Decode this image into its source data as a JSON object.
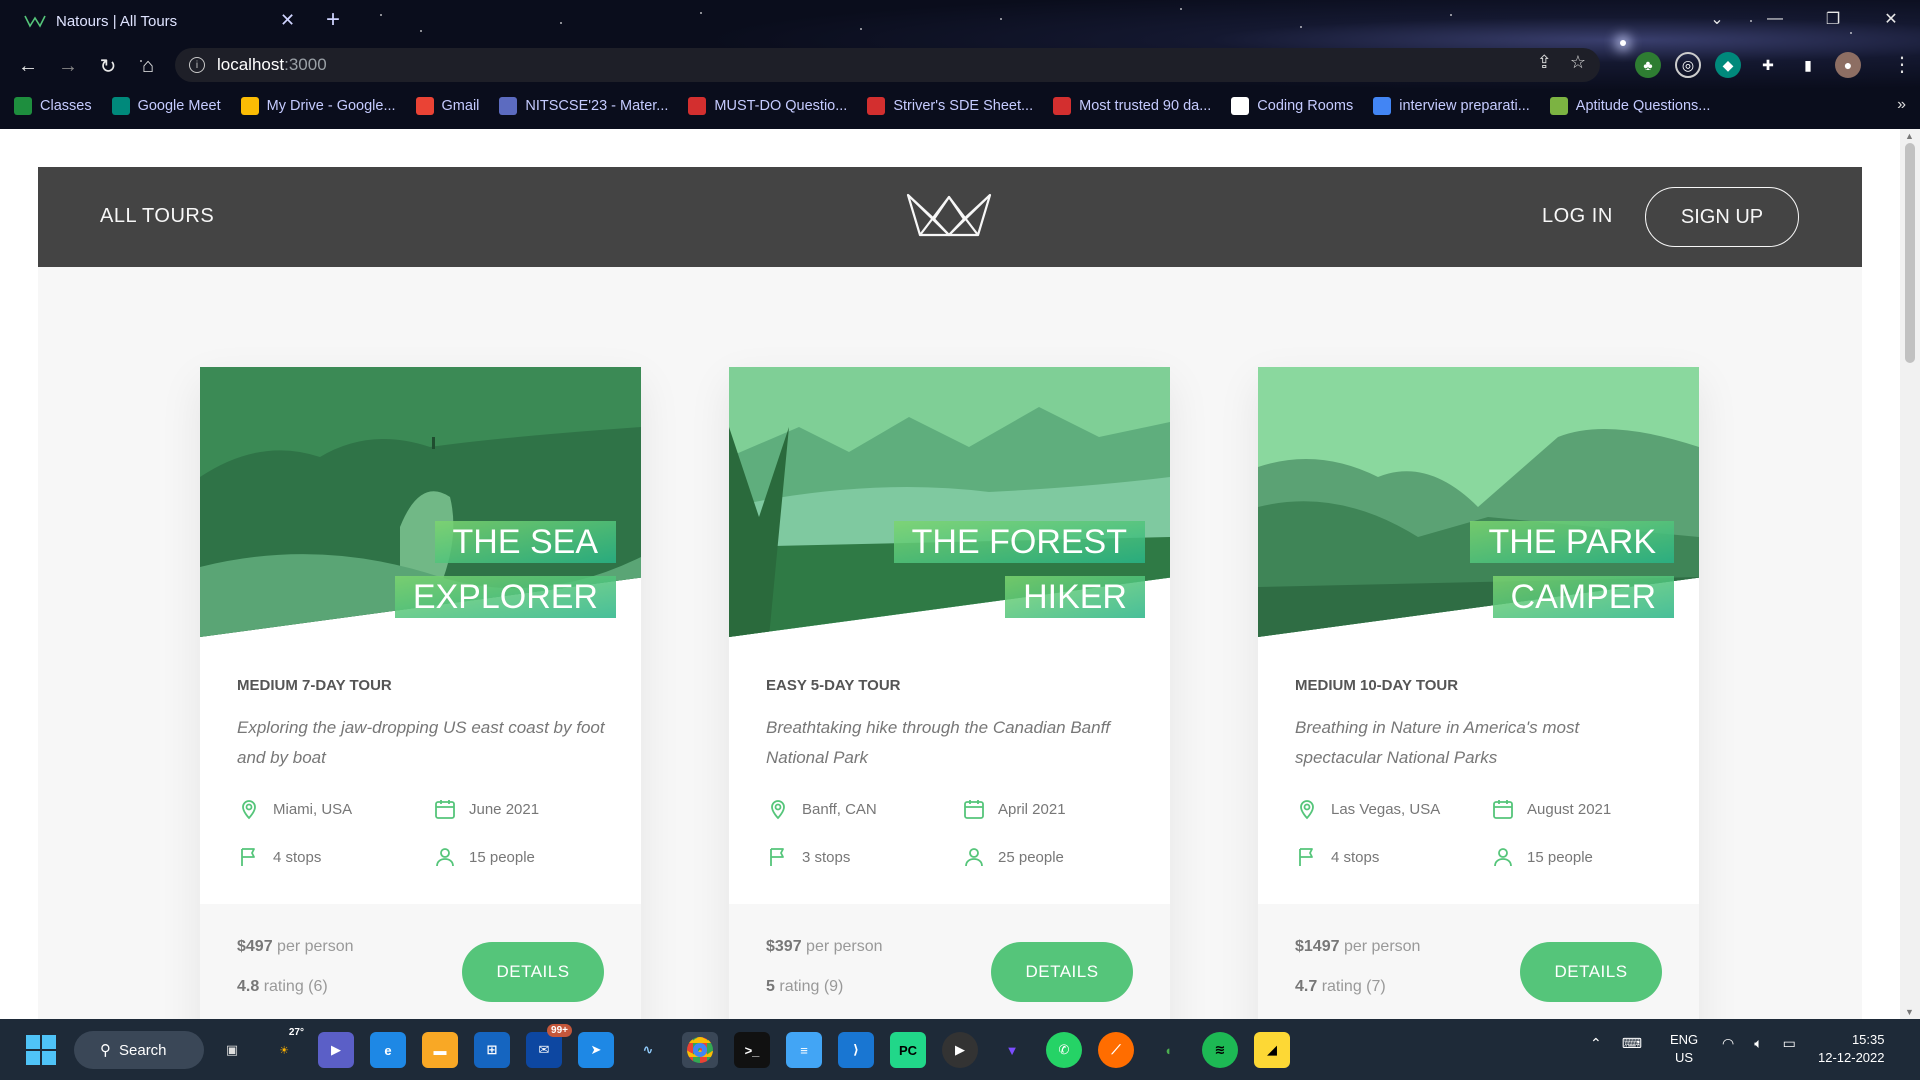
{
  "browser": {
    "tab_title": "Natours | All Tours",
    "url_host": "localhost",
    "url_port": ":3000",
    "bookmarks": [
      {
        "label": "Classes",
        "icon": "classroom-icon",
        "color": "#1e8e3e"
      },
      {
        "label": "Google Meet",
        "icon": "meet-icon",
        "color": "#00897b"
      },
      {
        "label": "My Drive - Google...",
        "icon": "drive-icon",
        "color": "#fbbc04"
      },
      {
        "label": "Gmail",
        "icon": "gmail-icon",
        "color": "#ea4335"
      },
      {
        "label": "NITSCSE'23 - Mater...",
        "icon": "book-icon",
        "color": "#5c6bc0"
      },
      {
        "label": "MUST-DO Questio...",
        "icon": "tuf-icon",
        "color": "#d32f2f"
      },
      {
        "label": "Striver's SDE Sheet...",
        "icon": "tuf-icon",
        "color": "#d32f2f"
      },
      {
        "label": "Most trusted 90 da...",
        "icon": "tuf-icon",
        "color": "#d32f2f"
      },
      {
        "label": "Coding Rooms",
        "icon": "coding-rooms-icon",
        "color": "#ffffff"
      },
      {
        "label": "interview preparati...",
        "icon": "docs-icon",
        "color": "#4285f4"
      },
      {
        "label": "Aptitude Questions...",
        "icon": "leaf-icon",
        "color": "#7cb342"
      }
    ]
  },
  "header": {
    "all_tours": "ALL TOURS",
    "log_in": "LOG IN",
    "sign_up": "SIGN UP"
  },
  "tours": [
    {
      "title_line1": "THE SEA",
      "title_line2": "EXPLORER",
      "subheading": "MEDIUM 7-DAY TOUR",
      "summary": "Exploring the jaw-dropping US east coast by foot and by boat",
      "location": "Miami, USA",
      "date": "June 2021",
      "stops": "4 stops",
      "people": "15 people",
      "price": "$497",
      "price_suffix": "per person",
      "rating": "4.8",
      "rating_suffix": "rating (6)",
      "button": "DETAILS"
    },
    {
      "title_line1": "THE FOREST",
      "title_line2": "HIKER",
      "subheading": "EASY 5-DAY TOUR",
      "summary": "Breathtaking hike through the Canadian Banff National Park",
      "location": "Banff, CAN",
      "date": "April 2021",
      "stops": "3 stops",
      "people": "25 people",
      "price": "$397",
      "price_suffix": "per person",
      "rating": "5",
      "rating_suffix": "rating (9)",
      "button": "DETAILS"
    },
    {
      "title_line1": "THE PARK",
      "title_line2": "CAMPER",
      "subheading": "MEDIUM 10-DAY TOUR",
      "summary": "Breathing in Nature in America's most spectacular National Parks",
      "location": "Las Vegas, USA",
      "date": "August 2021",
      "stops": "4 stops",
      "people": "15 people",
      "price": "$1497",
      "price_suffix": "per person",
      "rating": "4.7",
      "rating_suffix": "rating (7)",
      "button": "DETAILS"
    }
  ],
  "taskbar": {
    "search": "Search",
    "weather": "27°",
    "mail_badge": "99+",
    "lang_line1": "ENG",
    "lang_line2": "US",
    "time": "15:35",
    "date": "12-12-2022"
  },
  "colors": {
    "brand_green": "#55c57a",
    "header_grey": "#444444"
  }
}
